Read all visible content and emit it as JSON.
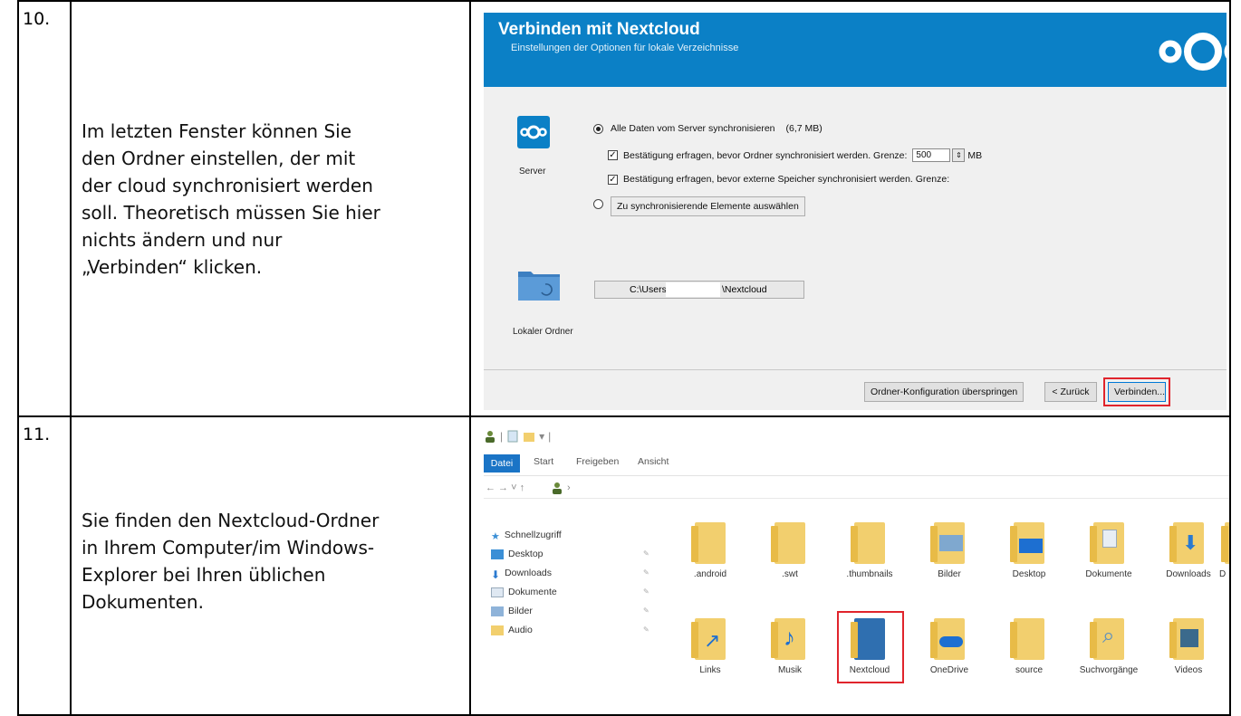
{
  "step1": {
    "number": "10.",
    "lines": [
      "Im letzten Fenster können Sie",
      "den Ordner einstellen, der mit",
      "der cloud synchronisiert werden",
      "soll. Theoretisch müssen Sie hier",
      "nichts ändern und nur",
      "„Verbinden“ klicken."
    ]
  },
  "step2": {
    "number": "11.",
    "lines": [
      "Sie finden den Nextcloud-Ordner",
      "in Ihrem Computer/im Windows-",
      "Explorer bei Ihren üblichen",
      "Dokumenten."
    ]
  },
  "dialog": {
    "title": "Verbinden mit Nextcloud",
    "subtitle": "Einstellungen der Optionen für lokale Verzeichnisse",
    "header_color": "#0b80c6",
    "server_label": "Server",
    "option_all": "Alle Daten vom Server synchronisieren",
    "option_all_size": "(6,7 MB)",
    "check_limit": "Bestätigung erfragen, bevor Ordner synchronisiert werden. Grenze:",
    "limit_value": "500",
    "limit_unit": "MB",
    "check_external": "Bestätigung erfragen, bevor externe Speicher synchronisiert werden. Grenze:",
    "option_select_button": "Zu synchronisierende Elemente auswählen",
    "local_folder_label": "Lokaler Ordner",
    "path_prefix": "C:\\Users\\",
    "path_suffix": "\\Nextcloud",
    "skip_button": "Ordner-Konfiguration überspringen",
    "back_button": "< Zurück",
    "connect_button": "Verbinden...",
    "highlight_color": "#e0242c"
  },
  "explorer": {
    "tabs": [
      "Datei",
      "Start",
      "Freigeben",
      "Ansicht"
    ],
    "address_arrows": "←  →  ˅  ↑",
    "address_crumb": "›",
    "nav_items": [
      "Schnellzugriff",
      "Desktop",
      "Downloads",
      "Dokumente",
      "Bilder",
      "Audio"
    ],
    "tiles_row1": [
      ".android",
      ".swt",
      ".thumbnails",
      "Bilder",
      "Desktop",
      "Dokumente",
      "Downloads",
      "D"
    ],
    "tiles_row2": [
      "Links",
      "Musik",
      "Nextcloud",
      "OneDrive",
      "source",
      "Suchvorgänge",
      "Videos"
    ]
  }
}
